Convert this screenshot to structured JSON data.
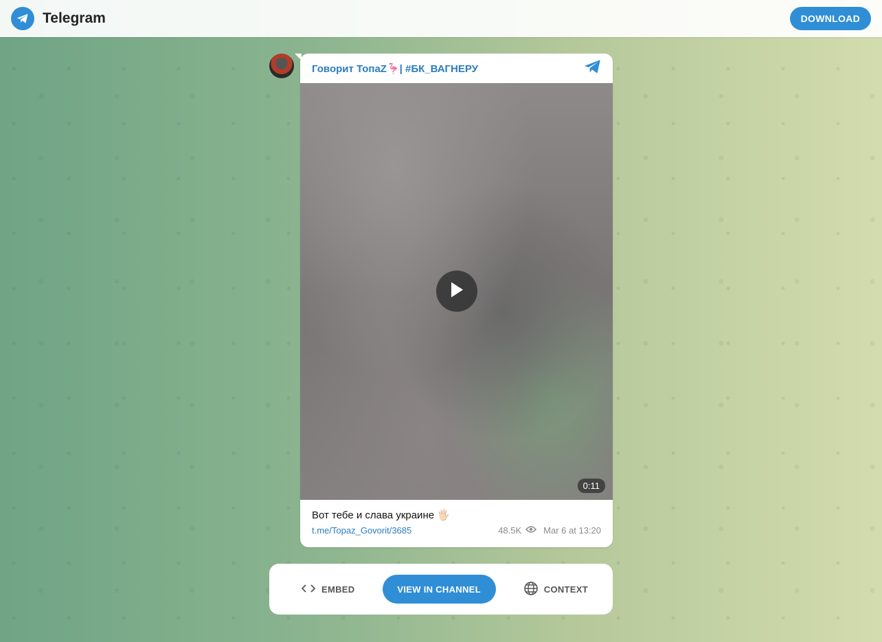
{
  "header": {
    "brand": "Telegram",
    "download_label": "DOWNLOAD"
  },
  "post": {
    "channel_name": "Говорит ТопаZ🦩| #БК_ВАГНЕРУ",
    "video_duration": "0:11",
    "caption": "Вот тебе и слава украине",
    "caption_emoji": "🖐🏻",
    "link": "t.me/Topaz_Govorit/3685",
    "views": "48.5K",
    "date": "Mar 6 at 13:20"
  },
  "actions": {
    "embed_label": "EMBED",
    "view_channel_label": "VIEW IN CHANNEL",
    "context_label": "CONTEXT"
  },
  "colors": {
    "accent": "#2f8ed6",
    "link": "#2a7cc0"
  },
  "icons": [
    "telegram-logo-icon",
    "telegram-plane-icon",
    "play-icon",
    "eye-icon",
    "code-icon",
    "globe-icon"
  ]
}
